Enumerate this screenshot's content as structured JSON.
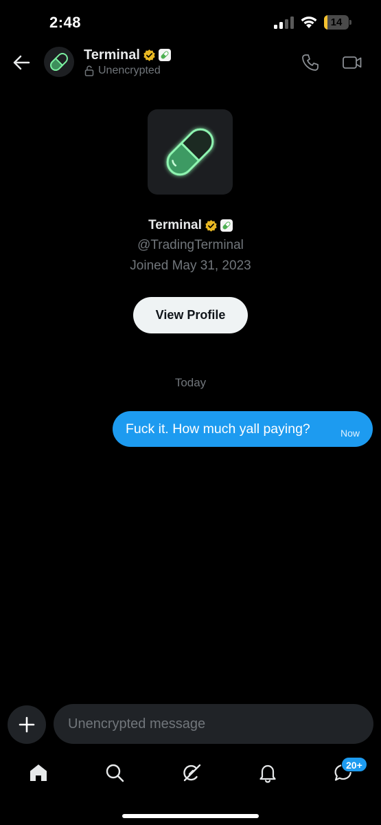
{
  "status_bar": {
    "time": "2:48",
    "battery_level": "14",
    "battery_fraction": 0.14,
    "battery_color": "#f5c230"
  },
  "header": {
    "title": "Terminal",
    "subtitle": "Unencrypted",
    "back_icon": "arrow-left-icon",
    "call_icon": "phone-icon",
    "video_icon": "video-camera-icon"
  },
  "profile": {
    "name": "Terminal",
    "handle": "@TradingTerminal",
    "joined": "Joined May 31, 2023",
    "view_profile_label": "View Profile",
    "avatar_icon": "pill-capsule-icon",
    "verified_icon": "verified-badge-icon",
    "verified_color": "#e8b823"
  },
  "conversation": {
    "date_separator": "Today",
    "messages": [
      {
        "text": "Fuck it. How much yall paying?",
        "time": "Now",
        "sent": true
      }
    ],
    "sent_bubble_color": "#1d9bf0"
  },
  "composer": {
    "placeholder": "Unencrypted message",
    "add_icon": "plus-icon"
  },
  "tab_bar": {
    "items": [
      {
        "name": "home",
        "icon": "home-icon"
      },
      {
        "name": "search",
        "icon": "search-icon"
      },
      {
        "name": "grok",
        "icon": "grok-icon"
      },
      {
        "name": "notifications",
        "icon": "bell-icon"
      },
      {
        "name": "messages",
        "icon": "messages-icon",
        "badge": "20+"
      }
    ],
    "badge_color": "#1d9bf0"
  }
}
